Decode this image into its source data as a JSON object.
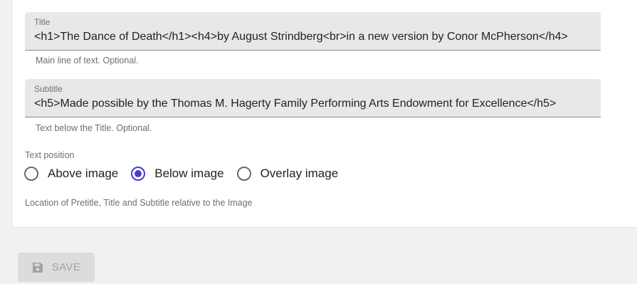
{
  "title_field": {
    "label": "Title",
    "value": "<h1>The Dance of Death</h1><h4>by August Strindberg<br>in a new version by Conor McPherson</h4>",
    "helper": "Main line of text. Optional."
  },
  "subtitle_field": {
    "label": "Subtitle",
    "value": "<h5>Made possible by the Thomas M. Hagerty Family Performing Arts Endowment for Excellence</h5>",
    "helper": "Text below the Title. Optional."
  },
  "text_position": {
    "label": "Text position",
    "options": [
      "Above image",
      "Below image",
      "Overlay image"
    ],
    "selected": "Below image",
    "helper": "Location of Pretitle, Title and Subtitle relative to the Image"
  },
  "save_button": {
    "label": "SAVE",
    "icon": "floppy-disk-icon",
    "disabled": true
  },
  "colors": {
    "accent": "#4a3ec9",
    "field_bg": "#e8e8e8",
    "page_bg": "#f1f1f1"
  }
}
